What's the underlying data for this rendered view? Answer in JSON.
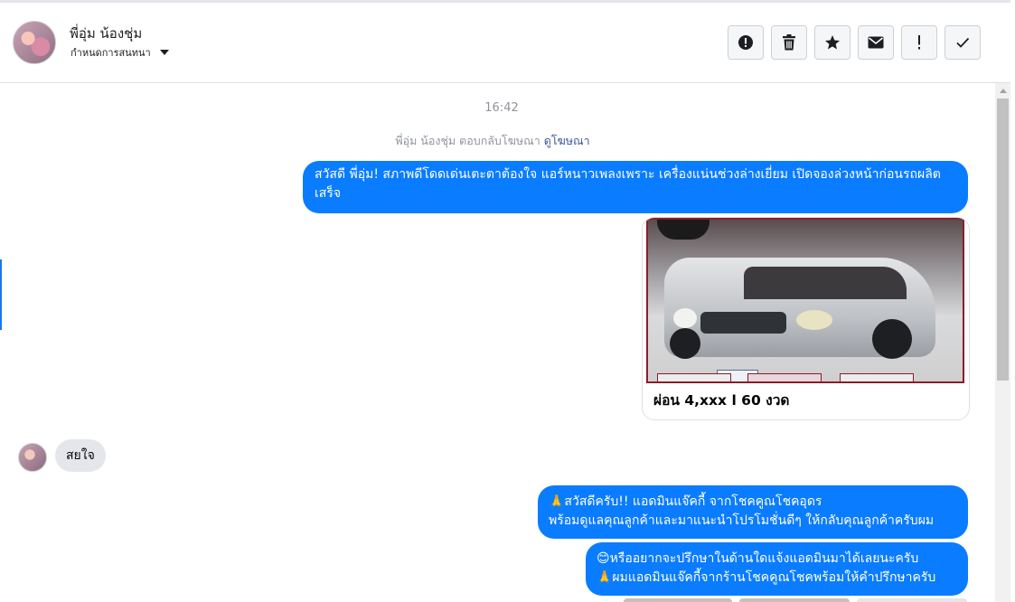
{
  "header": {
    "contact_name": "พี่อุ่ม น้องชุ่ม",
    "assign_label": "กำหนดการสนทนา",
    "tools": [
      {
        "name": "report-icon",
        "glyph": "!"
      },
      {
        "name": "trash-icon",
        "glyph": "🗑"
      },
      {
        "name": "star-icon",
        "glyph": "★"
      },
      {
        "name": "envelope-icon",
        "glyph": "✉"
      },
      {
        "name": "mark-important-icon",
        "glyph": "!"
      },
      {
        "name": "checkmark-icon",
        "glyph": "✓"
      }
    ]
  },
  "thread": {
    "timestamp": "16:42",
    "ad_reply_note": "พี่อุ่ม น้องชุ่ม ตอบกลับโฆษณา",
    "ad_reply_link": "ดูโฆษณา",
    "messages": [
      {
        "from": "page",
        "text": "สวัสดี พี่อุ่ม! สภาพดีโดดเด่นเตะตาต้องใจ แอร์หนาวเพลงเพราะ เครื่องแน่นช่วงล่างเยี่ยม เปิดจองล่วงหน้าก่อนรถผลิตเสร็จ"
      },
      {
        "from": "page",
        "type": "card",
        "caption": "ผ่อน 4,xxx l 60 งวด"
      },
      {
        "from": "customer",
        "text": "สยใจ"
      },
      {
        "from": "page",
        "line1": "🙏สวัสดีครับ!! แอดมินแจ๊คกี้ จากโชคคูณโชคอุดร",
        "line2": "พร้อมดูแลคุณลูกค้าและมาแนะนำโปรโมชั่นดีๆ ให้กลับคุณลูกค้าครับผม"
      },
      {
        "from": "page",
        "line1": "😊หรืออยากจะปรึกษาในด้านใดแจ้งแอดมินมาได้เลยนะครับ",
        "line2": "🙏ผมแอดมินแจ๊คกี้จากร้านโชคคูณโชคพร้อมให้คำปรึกษาครับ"
      }
    ]
  },
  "colors": {
    "outgoing_bubble": "#0a7cff",
    "incoming_bubble": "#e4e6eb",
    "link": "#385898"
  }
}
